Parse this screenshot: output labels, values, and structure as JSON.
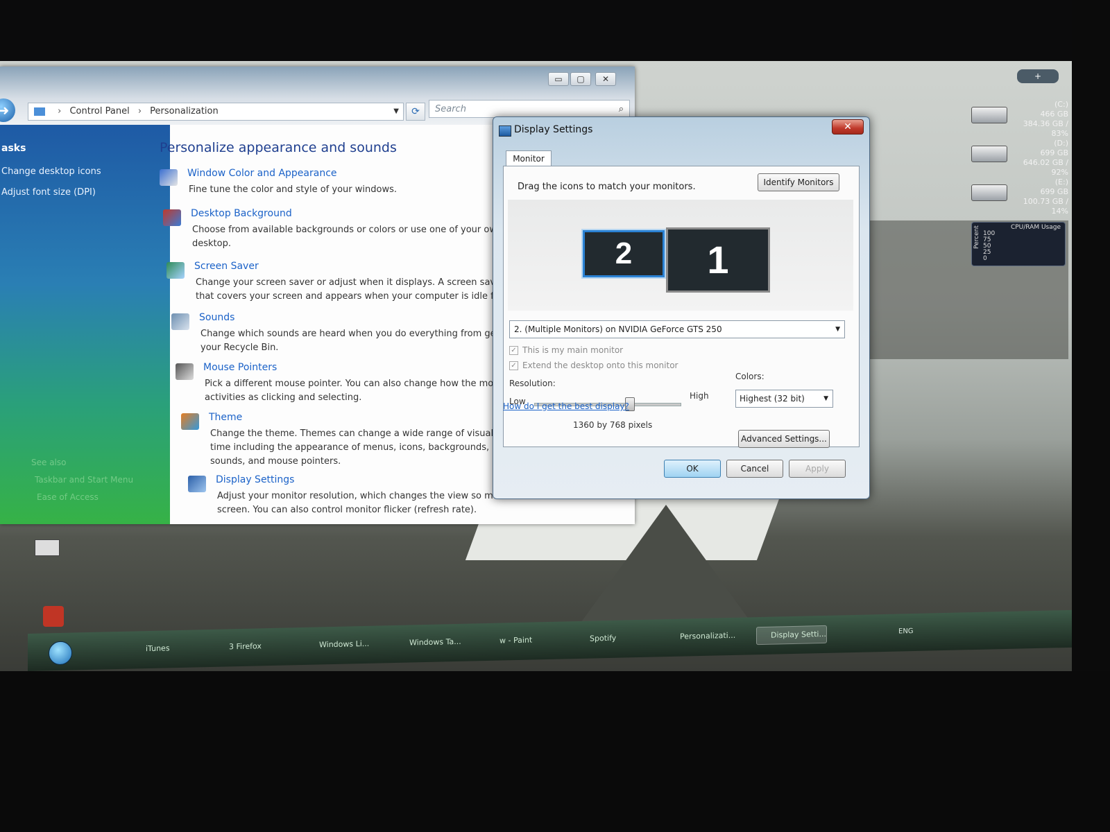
{
  "control_panel": {
    "address": {
      "part1": "Control Panel",
      "part2": "Personalization"
    },
    "search_placeholder": "Search",
    "caption_buttons": {
      "minimize": "▭",
      "maximize": "▢",
      "close": "✕"
    },
    "sidebar": {
      "heading": "asks",
      "links": [
        "Change desktop icons",
        "Adjust font size (DPI)"
      ],
      "see_also": [
        "See also",
        "Taskbar and Start Menu",
        "Ease of Access"
      ]
    },
    "heading": "Personalize appearance and sounds",
    "items": [
      {
        "title": "Window Color and Appearance",
        "desc": [
          "Fine tune the color and style of your windows."
        ]
      },
      {
        "title": "Desktop Background",
        "desc": [
          "Choose from available backgrounds or colors or use one of your own",
          "desktop."
        ]
      },
      {
        "title": "Screen Saver",
        "desc": [
          "Change your screen saver or adjust when it displays. A screen saver is",
          "that covers your screen and appears when your computer is idle for a"
        ]
      },
      {
        "title": "Sounds",
        "desc": [
          "Change which sounds are heard when you do everything from getting",
          "your Recycle Bin."
        ]
      },
      {
        "title": "Mouse Pointers",
        "desc": [
          "Pick a different mouse pointer. You can also change how the mouse",
          "activities as clicking and selecting."
        ]
      },
      {
        "title": "Theme",
        "desc": [
          "Change the theme. Themes can change a wide range of visual and a",
          "time including the appearance of menus, icons, backgrounds, screen",
          "sounds, and mouse pointers."
        ]
      },
      {
        "title": "Display Settings",
        "desc": [
          "Adjust your monitor resolution, which changes the view so more or",
          "screen. You can also control monitor flicker (refresh rate)."
        ]
      }
    ]
  },
  "dialog": {
    "title": "Display Settings",
    "close_label": "✕",
    "tab": "Monitor",
    "instruction": "Drag the icons to match your monitors.",
    "identify_label": "Identify Monitors",
    "monitor2_label": "2",
    "monitor1_label": "1",
    "monitor_select": "2. (Multiple Monitors) on NVIDIA GeForce GTS 250",
    "check_main": "This is my main monitor",
    "check_extend": "Extend the desktop onto this monitor",
    "resolution_label": "Resolution:",
    "low_label": "Low",
    "high_label": "High",
    "resolution_value": "1360 by 768 pixels",
    "resolution_slider_fraction": 0.65,
    "colors_label": "Colors:",
    "colors_value": "Highest (32 bit)",
    "advanced_label": "Advanced Settings...",
    "help_link": "How do I get the best display?",
    "ok_label": "OK",
    "cancel_label": "Cancel",
    "apply_label": "Apply"
  },
  "gadgets": {
    "drives": [
      {
        "name": "(C:)",
        "size": "466 GB",
        "free": "384.36 GB / 83%"
      },
      {
        "name": "(D:)",
        "size": "699 GB",
        "free": "646.02 GB / 92%"
      },
      {
        "name": "(E:)",
        "size": "699 GB",
        "free": "100.73 GB / 14%"
      }
    ],
    "cpu_title": "CPU/RAM Usage",
    "cpu_axis": "Percent",
    "cpu_ticks": [
      "100",
      "75",
      "50",
      "25",
      "0"
    ],
    "plus": "+"
  },
  "taskbar": {
    "tasks": [
      "iTunes",
      "3 Firefox",
      "Windows Li...",
      "Windows Ta...",
      "w - Paint",
      "Spotify",
      "Personalizati...",
      "Display Setti..."
    ],
    "tray_text": "ENG"
  }
}
